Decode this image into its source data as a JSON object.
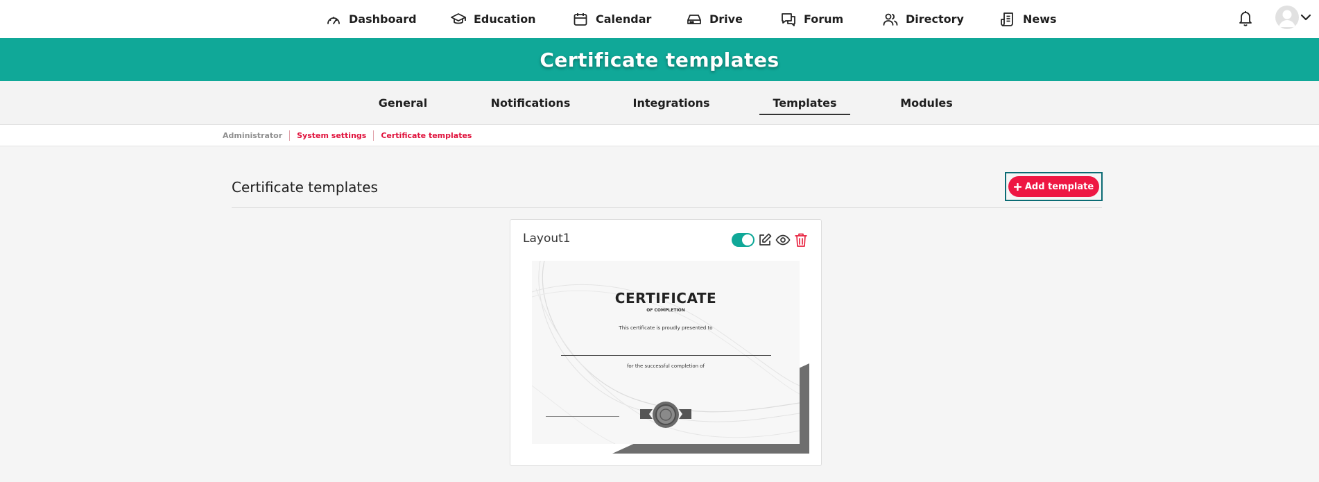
{
  "topnav": {
    "items": [
      {
        "label": "Dashboard",
        "icon": "gauge-icon"
      },
      {
        "label": "Education",
        "icon": "graduation-cap-icon"
      },
      {
        "label": "Calendar",
        "icon": "calendar-icon"
      },
      {
        "label": "Drive",
        "icon": "hard-drive-icon"
      },
      {
        "label": "Forum",
        "icon": "chat-bubbles-icon"
      },
      {
        "label": "Directory",
        "icon": "users-icon"
      },
      {
        "label": "News",
        "icon": "newspaper-icon"
      }
    ],
    "right_icons": [
      "bell-icon",
      "avatar-icon",
      "chevron-down-icon"
    ]
  },
  "banner": {
    "title": "Certificate templates"
  },
  "tabs": [
    {
      "label": "General",
      "active": false
    },
    {
      "label": "Notifications",
      "active": false
    },
    {
      "label": "Integrations",
      "active": false
    },
    {
      "label": "Templates",
      "active": true
    },
    {
      "label": "Modules",
      "active": false
    }
  ],
  "breadcrumb": [
    "Administrator",
    "System settings",
    "Certificate templates"
  ],
  "section": {
    "title": "Certificate templates",
    "add_button": "Add template"
  },
  "card": {
    "title": "Layout1",
    "enabled": true,
    "actions": [
      "toggle-switch",
      "edit-icon",
      "eye-icon",
      "trash-icon"
    ],
    "preview": {
      "heading": "CERTIFICATE",
      "subheading": "OF COMPLETION",
      "presented": "This certificate is proudly presented to",
      "for": "for the successful completion of"
    }
  },
  "colors": {
    "accent": "#10a898",
    "danger": "#ee1743",
    "focus_outline": "#0b6b74",
    "breadcrumb_link": "#e0123c"
  }
}
